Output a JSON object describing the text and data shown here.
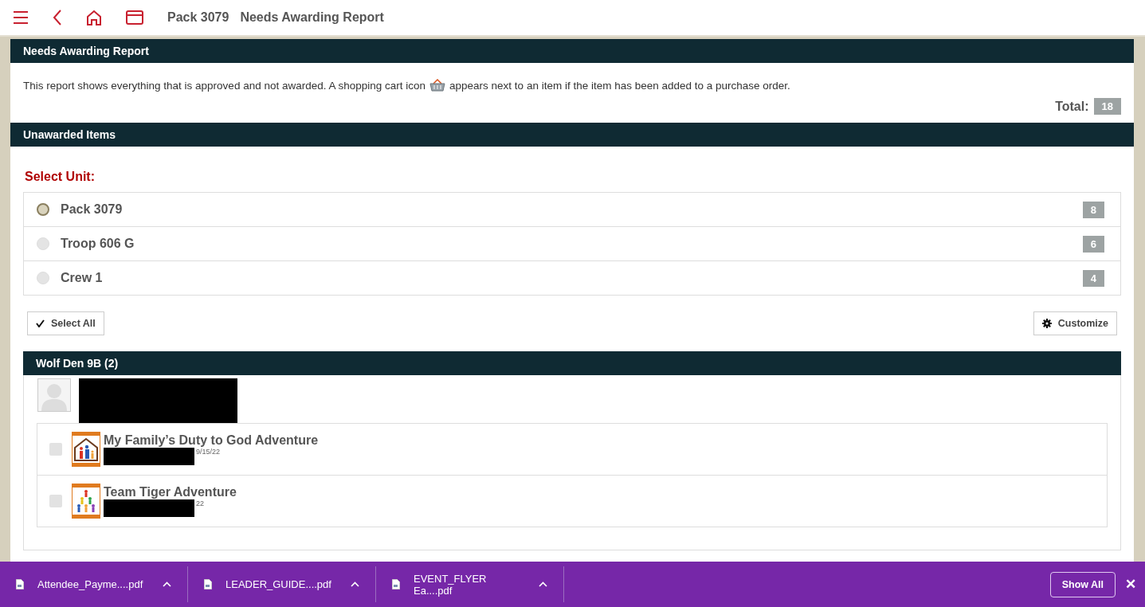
{
  "header": {
    "unit": "Pack 3079",
    "title": "Needs Awarding Report"
  },
  "report": {
    "title": "Needs Awarding Report",
    "description_before": "This report shows everything that is approved and not awarded. A shopping cart icon",
    "description_after": "appears next to an item if the item has been added to a purchase order.",
    "total_label": "Total:",
    "total": "18"
  },
  "unawarded": {
    "title": "Unawarded Items",
    "select_label": "Select Unit:",
    "units": [
      {
        "name": "Pack 3079",
        "count": "8",
        "selected": true
      },
      {
        "name": "Troop 606 G",
        "count": "6",
        "selected": false
      },
      {
        "name": "Crew 1",
        "count": "4",
        "selected": false
      }
    ],
    "select_all": "Select All",
    "customize": "Customize"
  },
  "group": {
    "title": "Wolf Den 9B (2)",
    "items": [
      {
        "title": "My Family’s Duty to God Adventure",
        "earned": "9/15/22",
        "checked": false,
        "kind": "house"
      },
      {
        "title": "Team Tiger Adventure",
        "earned": "22",
        "checked": false,
        "kind": "pyramid"
      }
    ]
  },
  "downloads": {
    "files": [
      {
        "name": "Attendee_Payme....pdf"
      },
      {
        "name": "LEADER_GUIDE....pdf"
      },
      {
        "name": "EVENT_FLYER Ea....pdf"
      }
    ],
    "show_all": "Show All",
    "close": "✕"
  }
}
